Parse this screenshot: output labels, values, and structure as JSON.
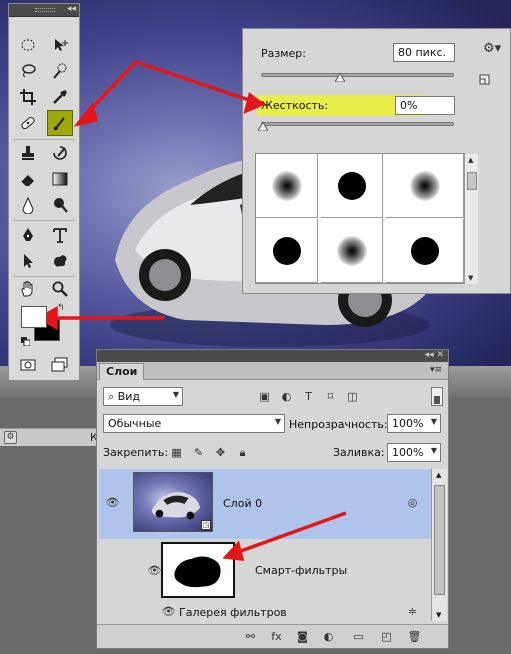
{
  "brush_panel": {
    "size_label": "Размер:",
    "size_value": "80 пикс.",
    "hardness_label": "Жесткость:",
    "hardness_value": "0%",
    "size_slider_fraction": 0.4,
    "hardness_slider_fraction": 0.0,
    "presets": [
      "soft-round",
      "hard-round",
      "soft-round",
      "hard-round",
      "soft-round",
      "hard-round"
    ],
    "highlight_color": "#e8ed4a"
  },
  "status": {
    "k_text": "К"
  },
  "toolbox": {
    "active_tool": "brush-tool",
    "active_color": "#9fa80c",
    "foreground_color": "#ffffff",
    "background_color": "#000000"
  },
  "layers_panel": {
    "tab_label": "Слои",
    "filter_kind": "Вид",
    "blend_mode": "Обычные",
    "opacity_label": "Непрозрачность:",
    "opacity_value": "100%",
    "lock_label": "Закрепить:",
    "fill_label": "Заливка:",
    "fill_value": "100%",
    "layer_name": "Слой 0",
    "smart_filters_label": "Смарт-фильтры",
    "filter_gallery_label": "Галерея фильтров",
    "selected_row_color": "#aec4eb"
  },
  "annotation_color": "#e3161a"
}
